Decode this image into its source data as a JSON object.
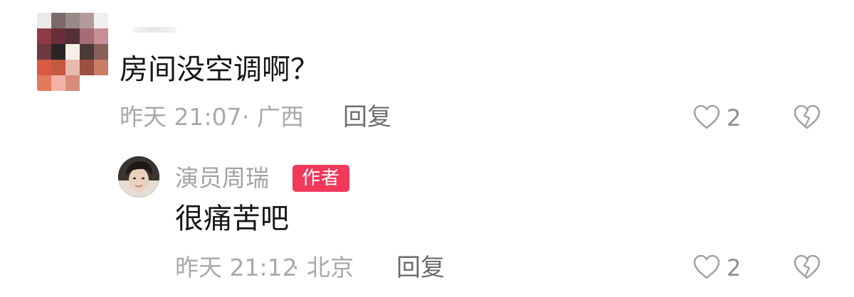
{
  "comment": {
    "text": "房间没空调啊？",
    "timestamp": "昨天 21:07",
    "location": "· 广西",
    "reply_label": "回复",
    "like_count": "2"
  },
  "reply": {
    "author_name": "演员周瑞",
    "author_badge": "作者",
    "text": "很痛苦吧",
    "timestamp": "昨天 21:12",
    "location": "· 北京",
    "reply_label": "回复",
    "like_count": "2"
  },
  "icons": {
    "like": "heart-outline-icon",
    "dislike": "broken-heart-icon"
  },
  "colors": {
    "author_badge_bg": "#f2395a",
    "meta_text": "#a9a9ad",
    "primary_text": "#161616"
  }
}
